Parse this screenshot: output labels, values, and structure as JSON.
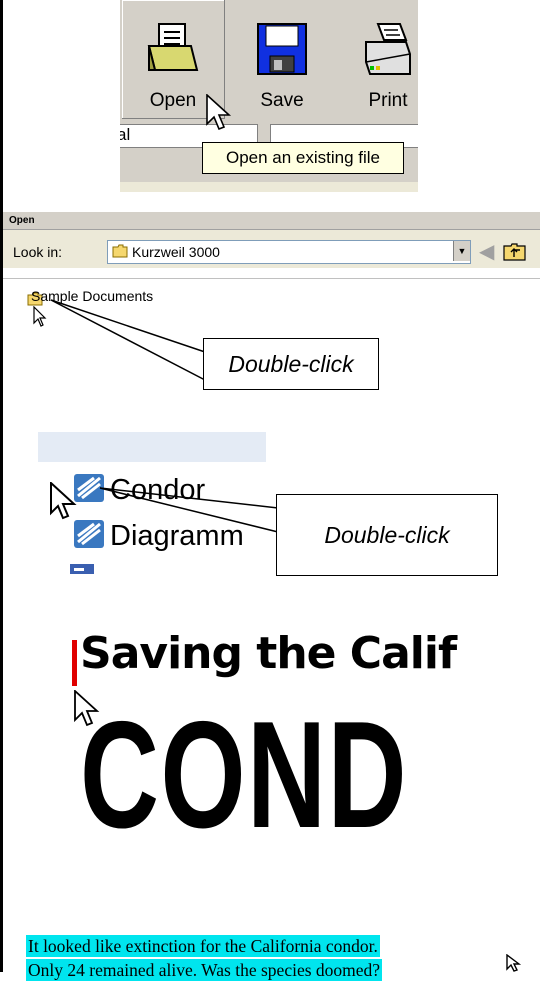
{
  "toolbar": {
    "buttons": [
      {
        "label": "Open",
        "icon": "open-folder-icon"
      },
      {
        "label": "Save",
        "icon": "floppy-disk-icon"
      },
      {
        "label": "Print",
        "icon": "printer-icon"
      }
    ],
    "field_value": "al",
    "tooltip": "Open an existing file"
  },
  "open_dialog": {
    "title": "Open",
    "look_in_label": "Look in:",
    "look_in_value": "Kurzweil 3000",
    "items": [
      "Sample Documents"
    ],
    "callout": "Double-click"
  },
  "file_list": {
    "items": [
      "Condor",
      "Diagramm"
    ],
    "callout": "Double-click"
  },
  "document": {
    "subtitle": "Saving the Calif",
    "heading": "COND",
    "highlighted_lines": [
      "It looked like extinction for the California condor.",
      "Only 24 remained alive. Was the species doomed?"
    ]
  },
  "colors": {
    "highlight": "#00e5ee",
    "tooltip_bg": "#ffffe1",
    "cursor_bar": "#e00000",
    "toolbar_bg": "#d4d0c8"
  }
}
